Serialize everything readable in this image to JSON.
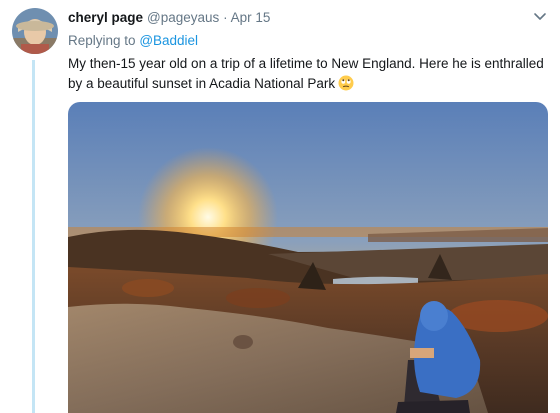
{
  "tweet": {
    "display_name": "cheryl page",
    "handle": "@pageyaus",
    "separator": "·",
    "date": "Apr 15",
    "replying_prefix": "Replying to",
    "replying_to": "@Baddiel",
    "text": "My then-15 year old on a trip of a lifetime to New England. Here he is enthralled by a beautiful sunset in Acadia National Park",
    "emoji": "rolling-eyes-emoji"
  },
  "icons": {
    "caret": "chevron-down-icon"
  },
  "colors": {
    "link": "#1b95e0",
    "secondary_text": "#657786",
    "thread_line": "#c4e5f5"
  }
}
